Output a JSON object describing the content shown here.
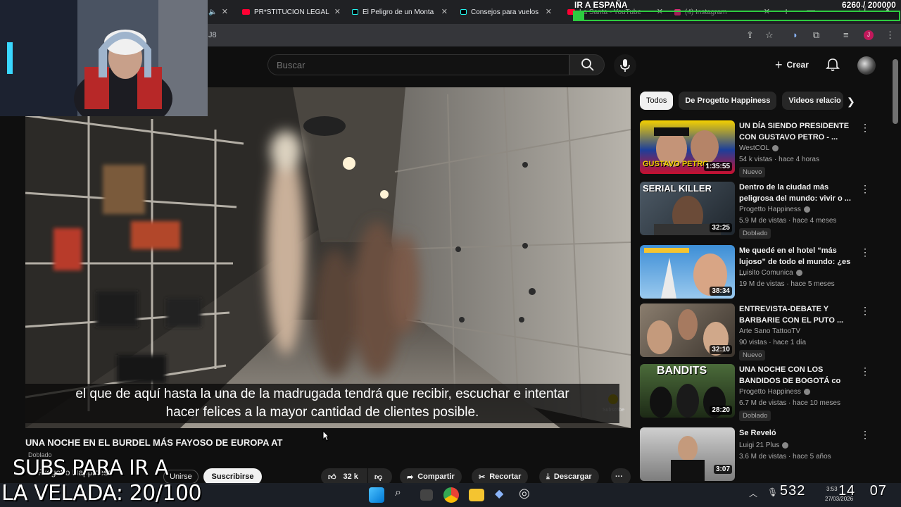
{
  "browser": {
    "tabs": [
      {
        "label": "PR*STITUCION LEGAL",
        "favicon_color": "#ff0033"
      },
      {
        "label": "El Peligro de un Monta",
        "favicon_color": "#111111"
      },
      {
        "label": "Consejos para vuelos",
        "favicon_color": "#111111"
      },
      {
        "label": "La Santa - YouTube",
        "favicon_color": "#ff0033"
      },
      {
        "label": "(4) Instagram",
        "favicon_color": "#d62976"
      }
    ],
    "address_fragment": "J8"
  },
  "search": {
    "placeholder": "Buscar"
  },
  "masthead": {
    "create_label": "Crear"
  },
  "player": {
    "caption_line1": "el que de aquí hasta la una de la madrugada tendrá que recibir, escuchar e intentar",
    "caption_line2": "hacer felices a la mayor cantidad de clientes posible.",
    "subscribe_watermark": "Subscribe"
  },
  "video": {
    "title": "UNA NOCHE EN EL BURDEL MÁS FAYOSO DE EUROPA AT",
    "dubbed": "Doblado",
    "channel": "Progetto Happiness",
    "join_label": "Unirse",
    "subscribe_label": "Suscribirse",
    "likes": "32 k",
    "share_label": "Compartir",
    "clip_label": "Recortar",
    "download_label": "Descargar"
  },
  "overlay": {
    "subs_goal": "SUBS PARA IR A",
    "velada": "LA VELADA: 20/100",
    "spain_goal": "IR A ESPAÑA",
    "sub_counter": "6260 / 200000",
    "goal_progress": 0.0313,
    "counter_left": "532",
    "counter_right": "14",
    "counter_right2": "07",
    "taskbar_time": "3:53",
    "taskbar_date": "27/03/2026"
  },
  "sidebar": {
    "chips": [
      "Todos",
      "De Progetto Happiness",
      "Videos relacio"
    ],
    "recommendations": [
      {
        "title": "UN DÍA SIENDO PRESIDENTE CON GUSTAVO PETRO - ...",
        "channel": "WestCOL",
        "meta": "54 k vistas · hace 4 horas",
        "badge": "Nuevo",
        "duration": "1:35:55",
        "thumb_text": "GUSTAVO PETRO"
      },
      {
        "title": "Dentro de la ciudad más peligrosa del mundo: vivir o ...",
        "channel": "Progetto Happiness",
        "meta": "5.9 M de vistas · hace 4 meses",
        "badge": "Doblado",
        "duration": "32:25",
        "thumb_text": "SERIAL KILLER"
      },
      {
        "title": "Me quedé en el hotel “más lujoso” de todo el mundo: ¿es ...",
        "channel": "Luisito Comunica",
        "meta": "19 M de vistas · hace 5 meses",
        "badge": "",
        "duration": "38:34",
        "thumb_text": ""
      },
      {
        "title": "ENTREVISTA-DEBATE Y BARBARIE CON EL PUTO ...",
        "channel": "Arte Sano TattooTV",
        "meta": "90 vistas · hace 1 día",
        "badge": "Nuevo",
        "duration": "32:10",
        "thumb_text": ""
      },
      {
        "title": "UNA NOCHE CON LOS BANDIDOS DE BOGOTÁ co",
        "channel": "Progetto Happiness",
        "meta": "6.7 M de vistas · hace 10 meses",
        "badge": "Doblado",
        "duration": "28:20",
        "thumb_text": "BANDITS"
      },
      {
        "title": "Se Reveló",
        "channel": "Luigi 21 Plus",
        "meta": "3.6 M de vistas · hace 5 años",
        "badge": "",
        "duration": "3:07",
        "thumb_text": ""
      }
    ]
  },
  "colors": {
    "accent": "#ff0033",
    "progress": "#2ecc40",
    "background": "#0f0f0f"
  }
}
